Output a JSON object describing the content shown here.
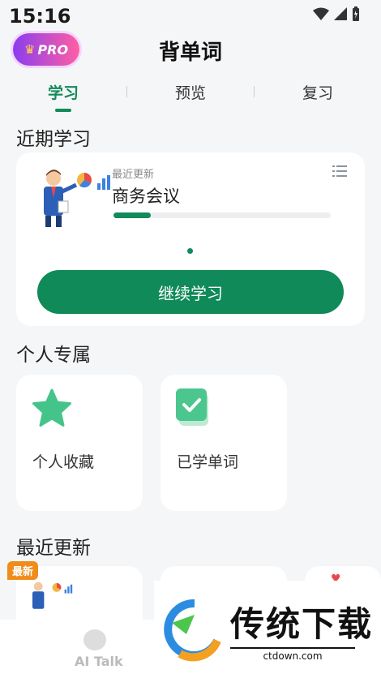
{
  "status_bar": {
    "time": "15:16"
  },
  "header": {
    "pro_badge": "PRO",
    "title": "背单词"
  },
  "tabs": [
    {
      "label": "学习",
      "active": true
    },
    {
      "label": "预览",
      "active": false
    },
    {
      "label": "复习",
      "active": false
    }
  ],
  "recent_study": {
    "section_title": "近期学习",
    "label": "最近更新",
    "book_name": "商务会议",
    "progress_fraction": 0.17,
    "continue_label": "继续学习"
  },
  "personal": {
    "section_title": "个人专属",
    "tiles": [
      {
        "label": "个人收藏",
        "icon": "star-icon"
      },
      {
        "label": "已学单词",
        "icon": "checked-book-icon"
      }
    ]
  },
  "latest_updates": {
    "section_title": "最近更新",
    "badge": "最新"
  },
  "bottom_nav": {
    "ai_talk_label": "AI Talk"
  },
  "watermark": {
    "text": "传统下载",
    "url": "ctdown.com"
  },
  "colors": {
    "accent": "#0f8a58",
    "badge": "#f08c1a"
  }
}
